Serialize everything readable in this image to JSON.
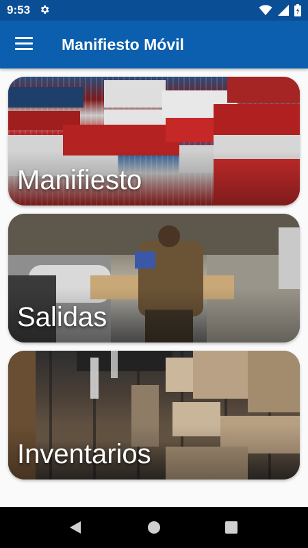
{
  "status_bar": {
    "time": "9:53",
    "icons": [
      "settings-icon",
      "wifi-icon",
      "signal-icon",
      "battery-icon"
    ]
  },
  "app_bar": {
    "title": "Manifiesto Móvil",
    "menu_icon": "hamburger-menu-icon"
  },
  "cards": [
    {
      "label": "Manifiesto"
    },
    {
      "label": "Salidas"
    },
    {
      "label": "Inventarios"
    }
  ],
  "nav_bar": {
    "icons": [
      "back-icon",
      "home-icon",
      "recents-icon"
    ]
  },
  "colors": {
    "status_bar": "#0a4f96",
    "app_bar": "#0b5fae",
    "background": "#fafafa",
    "nav_bar": "#000000"
  }
}
